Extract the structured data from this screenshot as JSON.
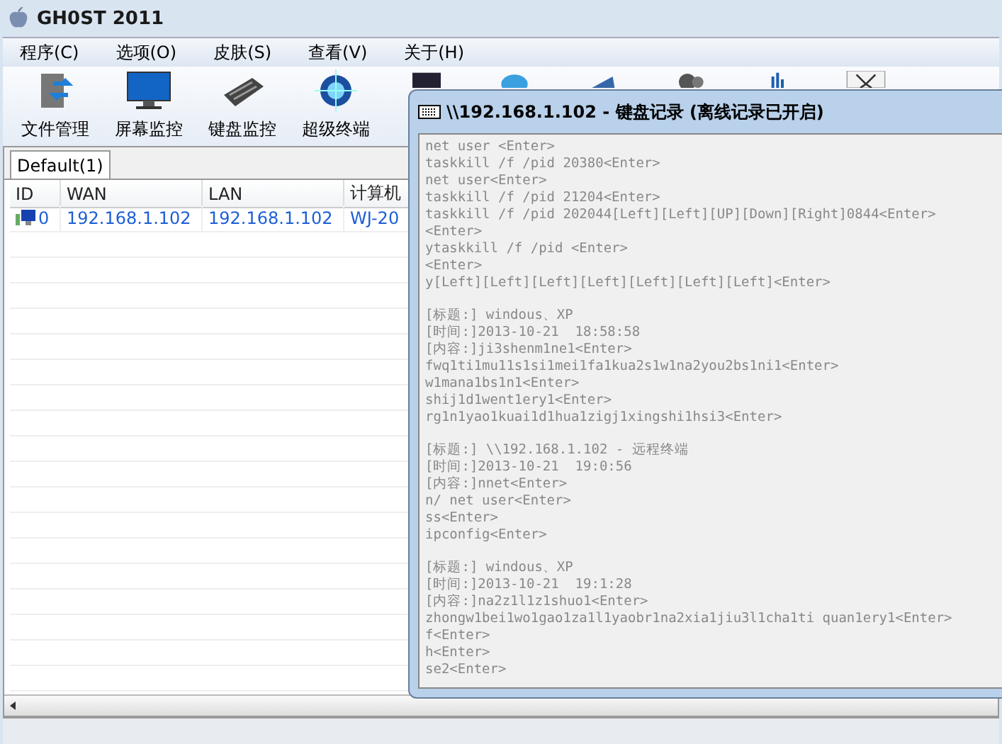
{
  "window": {
    "title": "GH0ST 2011"
  },
  "menu": [
    "程序(C)",
    "选项(O)",
    "皮肤(S)",
    "查看(V)",
    "关于(H)"
  ],
  "toolbar": [
    {
      "label": "文件管理",
      "kind": "files"
    },
    {
      "label": "屏幕监控",
      "kind": "monitor"
    },
    {
      "label": "键盘监控",
      "kind": "keyboard"
    },
    {
      "label": "超级终端",
      "kind": "terminal"
    }
  ],
  "tabs": [
    {
      "label": "Default(1)",
      "selected": true
    }
  ],
  "table": {
    "columns": [
      "ID",
      "WAN",
      "LAN",
      "计算机"
    ],
    "rows": [
      {
        "id": "0",
        "wan": "192.168.1.102",
        "lan": "192.168.1.102",
        "computer": "WJ-20"
      }
    ]
  },
  "dialog": {
    "title": "\\\\192.168.1.102 - 键盘记录 (离线记录已开启)",
    "blocks": [
      [
        "net user <Enter>",
        "taskkill /f /pid 20380<Enter>",
        "net user<Enter>",
        "taskkill /f /pid 21204<Enter>",
        "taskkill /f /pid 202044[Left][Left][UP][Down][Right]0844<Enter>",
        "<Enter>",
        "ytaskkill /f /pid <Enter>",
        "<Enter>",
        "y[Left][Left][Left][Left][Left][Left][Left]<Enter>"
      ],
      [
        "[标题:] windous、XP",
        "[时间:]2013-10-21  18:58:58",
        "[内容:]ji3shenm1ne1<Enter>",
        "fwq1ti1mu11s1si1mei1fa1kua2s1w1na2you2bs1ni1<Enter>",
        "w1mana1bs1n1<Enter>",
        "shij1d1went1ery1<Enter>",
        "rg1n1yao1kuai1d1hua1zigj1xingshi1hsi3<Enter>"
      ],
      [
        "[标题:] \\\\192.168.1.102 - 远程终端",
        "[时间:]2013-10-21  19:0:56",
        "[内容:]nnet<Enter>",
        "n/ net user<Enter>",
        "ss<Enter>",
        "ipconfig<Enter>"
      ],
      [
        "[标题:] windous、XP",
        "[时间:]2013-10-21  19:1:28",
        "[内容:]na2z1l1z1shuo1<Enter>",
        "zhongw1bei1wo1gao1za1l1yaobr1na2xia1jiu3l1cha1ti quan1ery1<Enter>",
        "f<Enter>",
        "h<Enter>",
        "se2<Enter>"
      ]
    ]
  }
}
